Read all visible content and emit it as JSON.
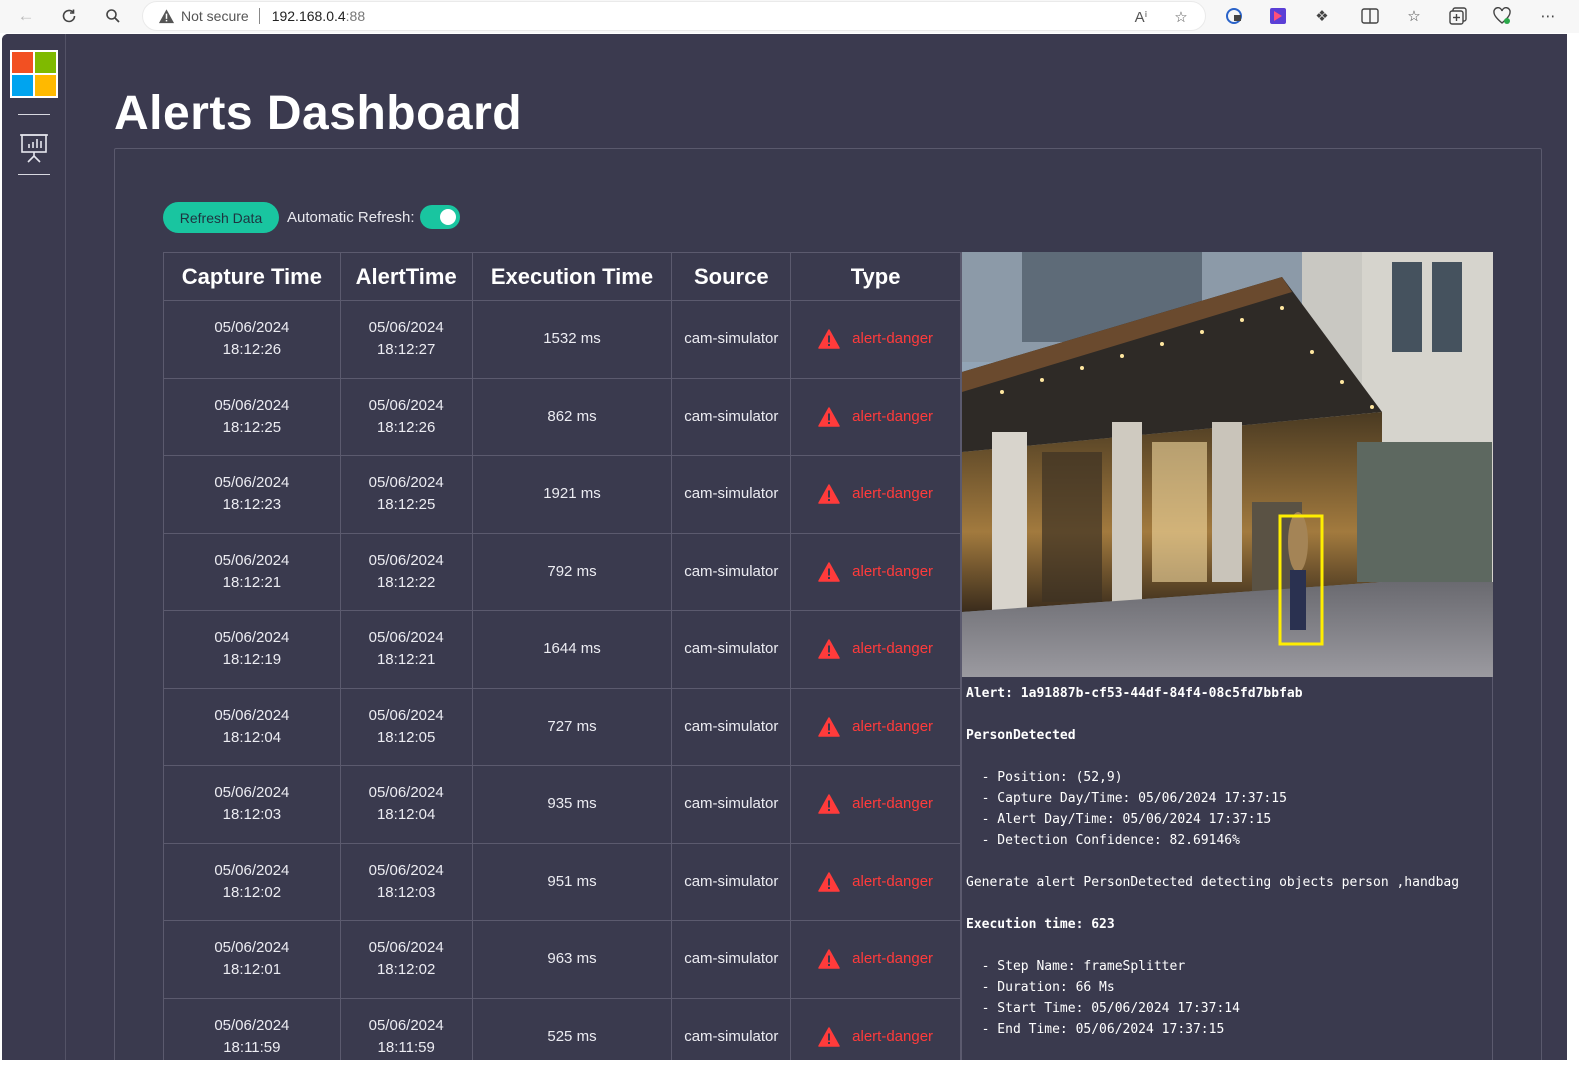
{
  "browser": {
    "security_label": "Not secure",
    "url_host": "192.168.0.4",
    "url_port": ":88"
  },
  "page": {
    "title": "Alerts Dashboard"
  },
  "controls": {
    "refresh_label": "Refresh Data",
    "auto_refresh_label": "Automatic Refresh:",
    "auto_refresh_on": true
  },
  "table": {
    "headers": [
      "Capture Time",
      "AlertTime",
      "Execution Time",
      "Source",
      "Type"
    ],
    "rows": [
      {
        "capture_date": "05/06/2024",
        "capture_time": "18:12:26",
        "alert_date": "05/06/2024",
        "alert_time": "18:12:27",
        "execution": "1532 ms",
        "source": "cam-simulator",
        "type": "alert-danger"
      },
      {
        "capture_date": "05/06/2024",
        "capture_time": "18:12:25",
        "alert_date": "05/06/2024",
        "alert_time": "18:12:26",
        "execution": "862 ms",
        "source": "cam-simulator",
        "type": "alert-danger"
      },
      {
        "capture_date": "05/06/2024",
        "capture_time": "18:12:23",
        "alert_date": "05/06/2024",
        "alert_time": "18:12:25",
        "execution": "1921 ms",
        "source": "cam-simulator",
        "type": "alert-danger"
      },
      {
        "capture_date": "05/06/2024",
        "capture_time": "18:12:21",
        "alert_date": "05/06/2024",
        "alert_time": "18:12:22",
        "execution": "792 ms",
        "source": "cam-simulator",
        "type": "alert-danger"
      },
      {
        "capture_date": "05/06/2024",
        "capture_time": "18:12:19",
        "alert_date": "05/06/2024",
        "alert_time": "18:12:21",
        "execution": "1644 ms",
        "source": "cam-simulator",
        "type": "alert-danger"
      },
      {
        "capture_date": "05/06/2024",
        "capture_time": "18:12:04",
        "alert_date": "05/06/2024",
        "alert_time": "18:12:05",
        "execution": "727 ms",
        "source": "cam-simulator",
        "type": "alert-danger"
      },
      {
        "capture_date": "05/06/2024",
        "capture_time": "18:12:03",
        "alert_date": "05/06/2024",
        "alert_time": "18:12:04",
        "execution": "935 ms",
        "source": "cam-simulator",
        "type": "alert-danger"
      },
      {
        "capture_date": "05/06/2024",
        "capture_time": "18:12:02",
        "alert_date": "05/06/2024",
        "alert_time": "18:12:03",
        "execution": "951 ms",
        "source": "cam-simulator",
        "type": "alert-danger"
      },
      {
        "capture_date": "05/06/2024",
        "capture_time": "18:12:01",
        "alert_date": "05/06/2024",
        "alert_time": "18:12:02",
        "execution": "963 ms",
        "source": "cam-simulator",
        "type": "alert-danger"
      },
      {
        "capture_date": "05/06/2024",
        "capture_time": "18:11:59",
        "alert_date": "05/06/2024",
        "alert_time": "18:11:59",
        "execution": "525 ms",
        "source": "cam-simulator",
        "type": "alert-danger"
      }
    ]
  },
  "detail": {
    "alert_line": "Alert: 1a91887b-cf53-44df-84f4-08c5fd7bbfab",
    "event_name": "PersonDetected",
    "position": "  - Position: (52,9)",
    "capture": "  - Capture Day/Time: 05/06/2024 17:37:15",
    "alert": "  - Alert Day/Time: 05/06/2024 17:37:15",
    "confidence": "  - Detection Confidence: 82.69146%",
    "generate": "Generate alert PersonDetected detecting objects person ,handbag",
    "execution": "Execution time: 623",
    "step": "  - Step Name: frameSplitter",
    "duration": "  - Duration: 66 Ms",
    "start": "  - Start Time: 05/06/2024 17:37:14",
    "end": "  - End Time: 05/06/2024 17:37:15"
  },
  "colors": {
    "background": "#3b3a4f",
    "accent": "#19c5a0",
    "danger": "#ff3b3b",
    "bbox": "#ffee00"
  },
  "icons": [
    "back-arrow-icon",
    "reload-icon",
    "search-icon",
    "warning-icon",
    "read-aloud-icon",
    "star-icon",
    "extensions-icon",
    "split-screen-icon",
    "favorites-icon",
    "collections-icon",
    "health-icon",
    "more-icon",
    "microsoft-logo",
    "presentation-chart-icon",
    "alert-triangle-icon"
  ]
}
